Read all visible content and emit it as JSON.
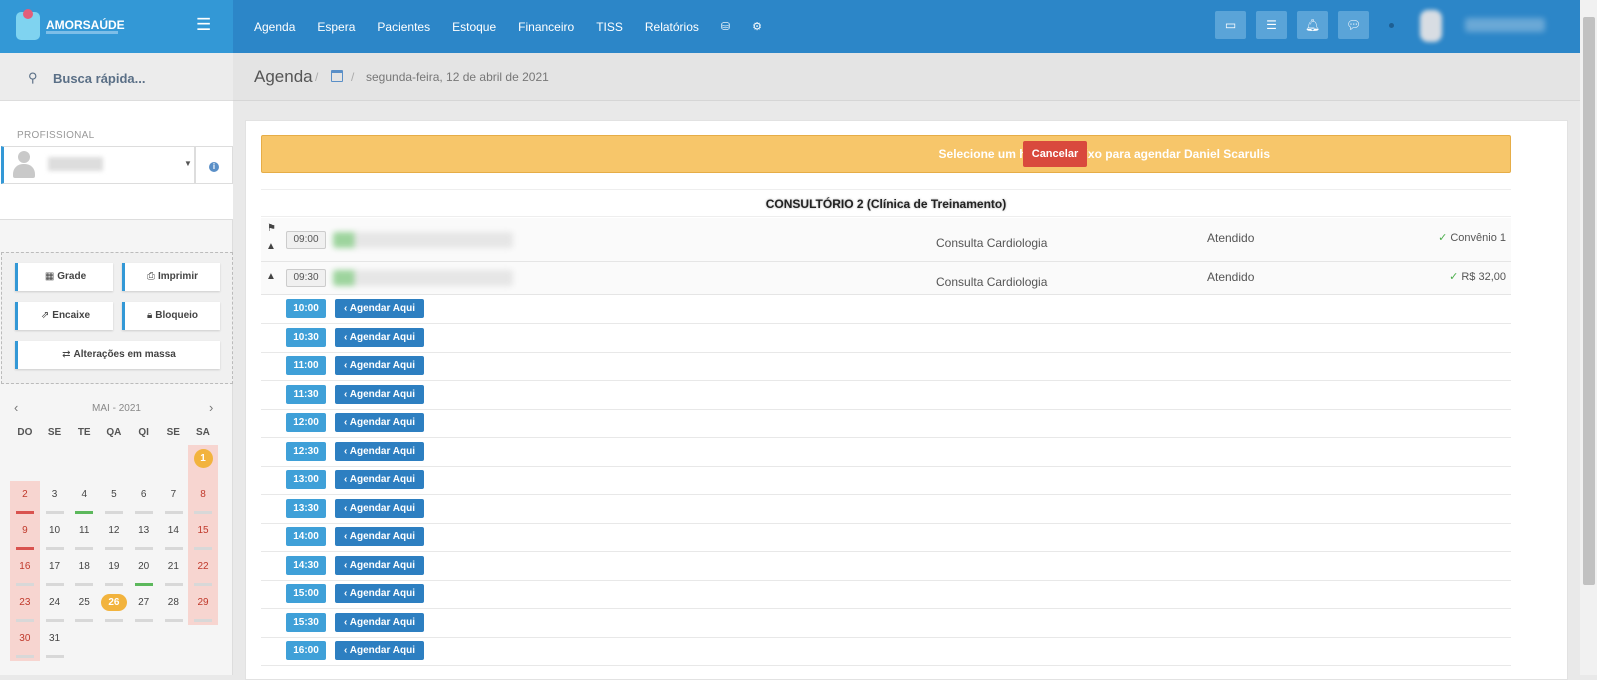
{
  "app": {
    "brand": "AMORSAÚDE",
    "menu_icon": "hamburger-icon"
  },
  "nav": {
    "items": [
      "Agenda",
      "Espera",
      "Pacientes",
      "Estoque",
      "Financeiro",
      "TISS",
      "Relatórios"
    ],
    "icons": [
      "database-icon",
      "gear-icon"
    ]
  },
  "topbar": {
    "buttons": [
      "inbox-icon",
      "list-icon",
      "bell-icon",
      "chat-icon"
    ]
  },
  "sidebar": {
    "search_placeholder": "Busca rápida...",
    "professional_label": "PROFISSIONAL",
    "actions": {
      "grade": "Grade",
      "imprimir": "Imprimir",
      "encaixe": "Encaixe",
      "bloqueio": "Bloqueio",
      "alteracoes": "Alterações em massa"
    },
    "calendar": {
      "title": "MAI - 2021",
      "weekdays": [
        "DO",
        "SE",
        "TE",
        "QA",
        "QI",
        "SE",
        "SA"
      ],
      "selected_day": "26",
      "highlighted_day": "1"
    }
  },
  "header": {
    "title": "Agenda",
    "date": "segunda-feira, 12 de abril de 2021"
  },
  "alert": {
    "text": "Selecione um horário abaixo para agendar Daniel Scarulis",
    "cancel_label": "Cancelar"
  },
  "room": "CONSULTÓRIO 2 (Clínica de Treinamento)",
  "appointments": [
    {
      "time": "09:00",
      "procedure": "Consulta Cardiologia",
      "status": "Atendido",
      "payment": "Convênio 1"
    },
    {
      "time": "09:30",
      "procedure": "Consulta Cardiologia",
      "status": "Atendido",
      "payment": "R$ 32,00"
    }
  ],
  "slots": {
    "button_label": "Agendar Aqui",
    "times": [
      "10:00",
      "10:30",
      "11:00",
      "11:30",
      "12:00",
      "12:30",
      "13:00",
      "13:30",
      "14:00",
      "14:30",
      "15:00",
      "15:30",
      "16:00"
    ]
  },
  "colors": {
    "topbar": "#2c86c8",
    "brand": "#3398d6",
    "alert": "#f7c66a",
    "cancel": "#d9493d",
    "slot": "#3fa0d8",
    "book": "#2d7fc1"
  }
}
